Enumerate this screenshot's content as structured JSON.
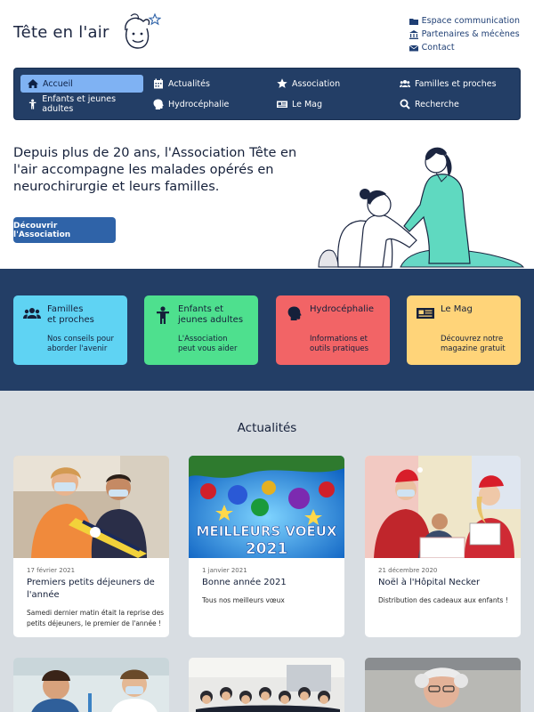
{
  "header": {
    "logo_text": "Tête en l'air",
    "top_links": [
      {
        "label": "Espace communication",
        "icon": "folder-icon"
      },
      {
        "label": "Partenaires & mécènes",
        "icon": "bank-icon"
      },
      {
        "label": "Contact",
        "icon": "envelope-icon"
      }
    ]
  },
  "nav": {
    "items": [
      {
        "label": "Accueil",
        "icon": "home-icon",
        "active": true
      },
      {
        "label": "Actualités",
        "icon": "calendar-icon"
      },
      {
        "label": "Association",
        "icon": "star-icon"
      },
      {
        "label": "Familles et proches",
        "icon": "users-icon"
      },
      {
        "label": "Enfants et jeunes adultes",
        "icon": "child-icon"
      },
      {
        "label": "Hydrocéphalie",
        "icon": "head-icon"
      },
      {
        "label": "Le Mag",
        "icon": "newspaper-icon"
      },
      {
        "label": "Recherche",
        "icon": "search-icon"
      }
    ]
  },
  "hero": {
    "text": "Depuis plus de 20 ans, l'Association Tête en l'air accompagne les malades opérés en neurochirurgie et leurs familles.",
    "button": "Découvrir l'Association"
  },
  "categories": [
    {
      "title": "Familles\net proches",
      "desc": "Nos conseils pour\naborder l'avenir",
      "color": "#5fd3f3",
      "icon": "users-icon"
    },
    {
      "title": "Enfants et\njeunes adultes",
      "desc": "L'Association\npeut vous aider",
      "color": "#4ee08e",
      "icon": "child-icon"
    },
    {
      "title": "Hydrocéphalie",
      "desc": "Informations et\noutils pratiques",
      "color": "#f26466",
      "icon": "head-icon"
    },
    {
      "title": "Le Mag",
      "desc": "Découvrez notre\nmagazine gratuit",
      "color": "#ffd479",
      "icon": "newspaper-icon"
    }
  ],
  "news": {
    "title": "Actualités",
    "items": [
      {
        "date": "17 février 2021",
        "title": "Premiers petits déjeuners de l'année",
        "summary": "Samedi dernier matin était la reprise des petits déjeuners, le premier de l'année !"
      },
      {
        "date": "1 janvier 2021",
        "title": "Bonne année 2021",
        "summary": "Tous nos meilleurs vœux",
        "image_text_1": "MEILLEURS VOEUX",
        "image_text_2": "2021"
      },
      {
        "date": "21 décembre 2020",
        "title": "Noël à l'Hôpital Necker",
        "summary": "Distribution des cadeaux aux enfants !"
      }
    ]
  }
}
